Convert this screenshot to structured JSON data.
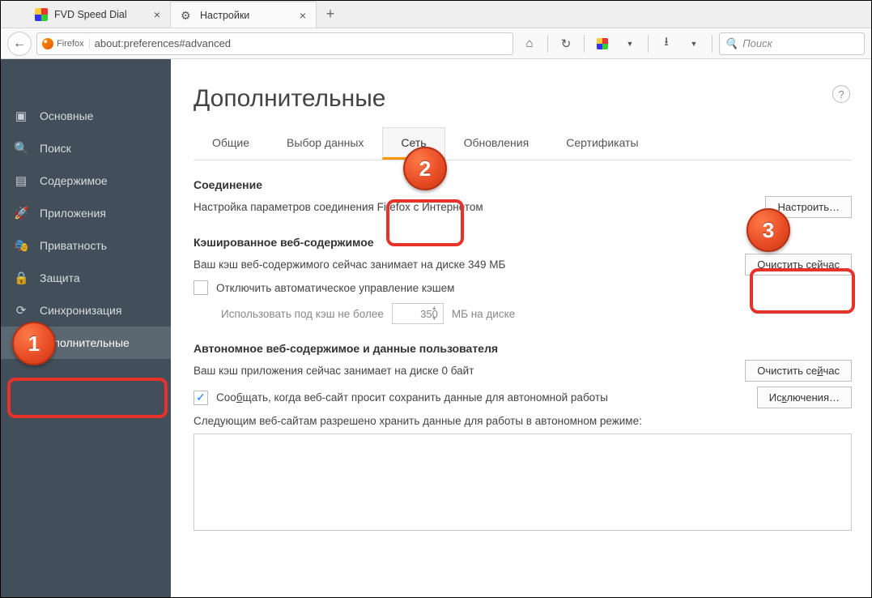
{
  "tabs": {
    "0": {
      "label": "FVD Speed Dial"
    },
    "1": {
      "label": "Настройки"
    }
  },
  "url": {
    "badge": "Firefox",
    "address": "about:preferences#advanced"
  },
  "search": {
    "placeholder": "Поиск"
  },
  "sidebar": {
    "items": [
      {
        "label": "Основные"
      },
      {
        "label": "Поиск"
      },
      {
        "label": "Содержимое"
      },
      {
        "label": "Приложения"
      },
      {
        "label": "Приватность"
      },
      {
        "label": "Защита"
      },
      {
        "label": "Синхронизация"
      },
      {
        "label": "Дополнительные"
      }
    ]
  },
  "page": {
    "title": "Дополнительные"
  },
  "subtabs": {
    "general": "Общие",
    "data": "Выбор данных",
    "network": "Сеть",
    "updates": "Обновления",
    "certs": "Сертификаты"
  },
  "conn": {
    "title": "Соединение",
    "desc": "Настройка параметров соединения Firefox с Интернетом",
    "btn": "Настроить…"
  },
  "cache": {
    "title": "Кэшированное веб-содержимое",
    "desc": "Ваш кэш веб-содержимого сейчас занимает на диске 349 МБ",
    "clear": "Очистить сейчас",
    "override": "Отключить автоматическое управление кэшем",
    "limit_prefix": "Использовать под кэш не более",
    "limit_value": "350",
    "limit_suffix": "МБ на диске"
  },
  "offline": {
    "title": "Автономное веб-содержимое и данные пользователя",
    "desc": "Ваш кэш приложения сейчас занимает на диске 0 байт",
    "clear": "Очистить сейчас",
    "notify": "Сообщать, когда веб-сайт просит сохранить данные для автономной работы",
    "exceptions": "Исключения…",
    "allowed": "Следующим веб-сайтам разрешено хранить данные для работы в автономном режиме:"
  }
}
